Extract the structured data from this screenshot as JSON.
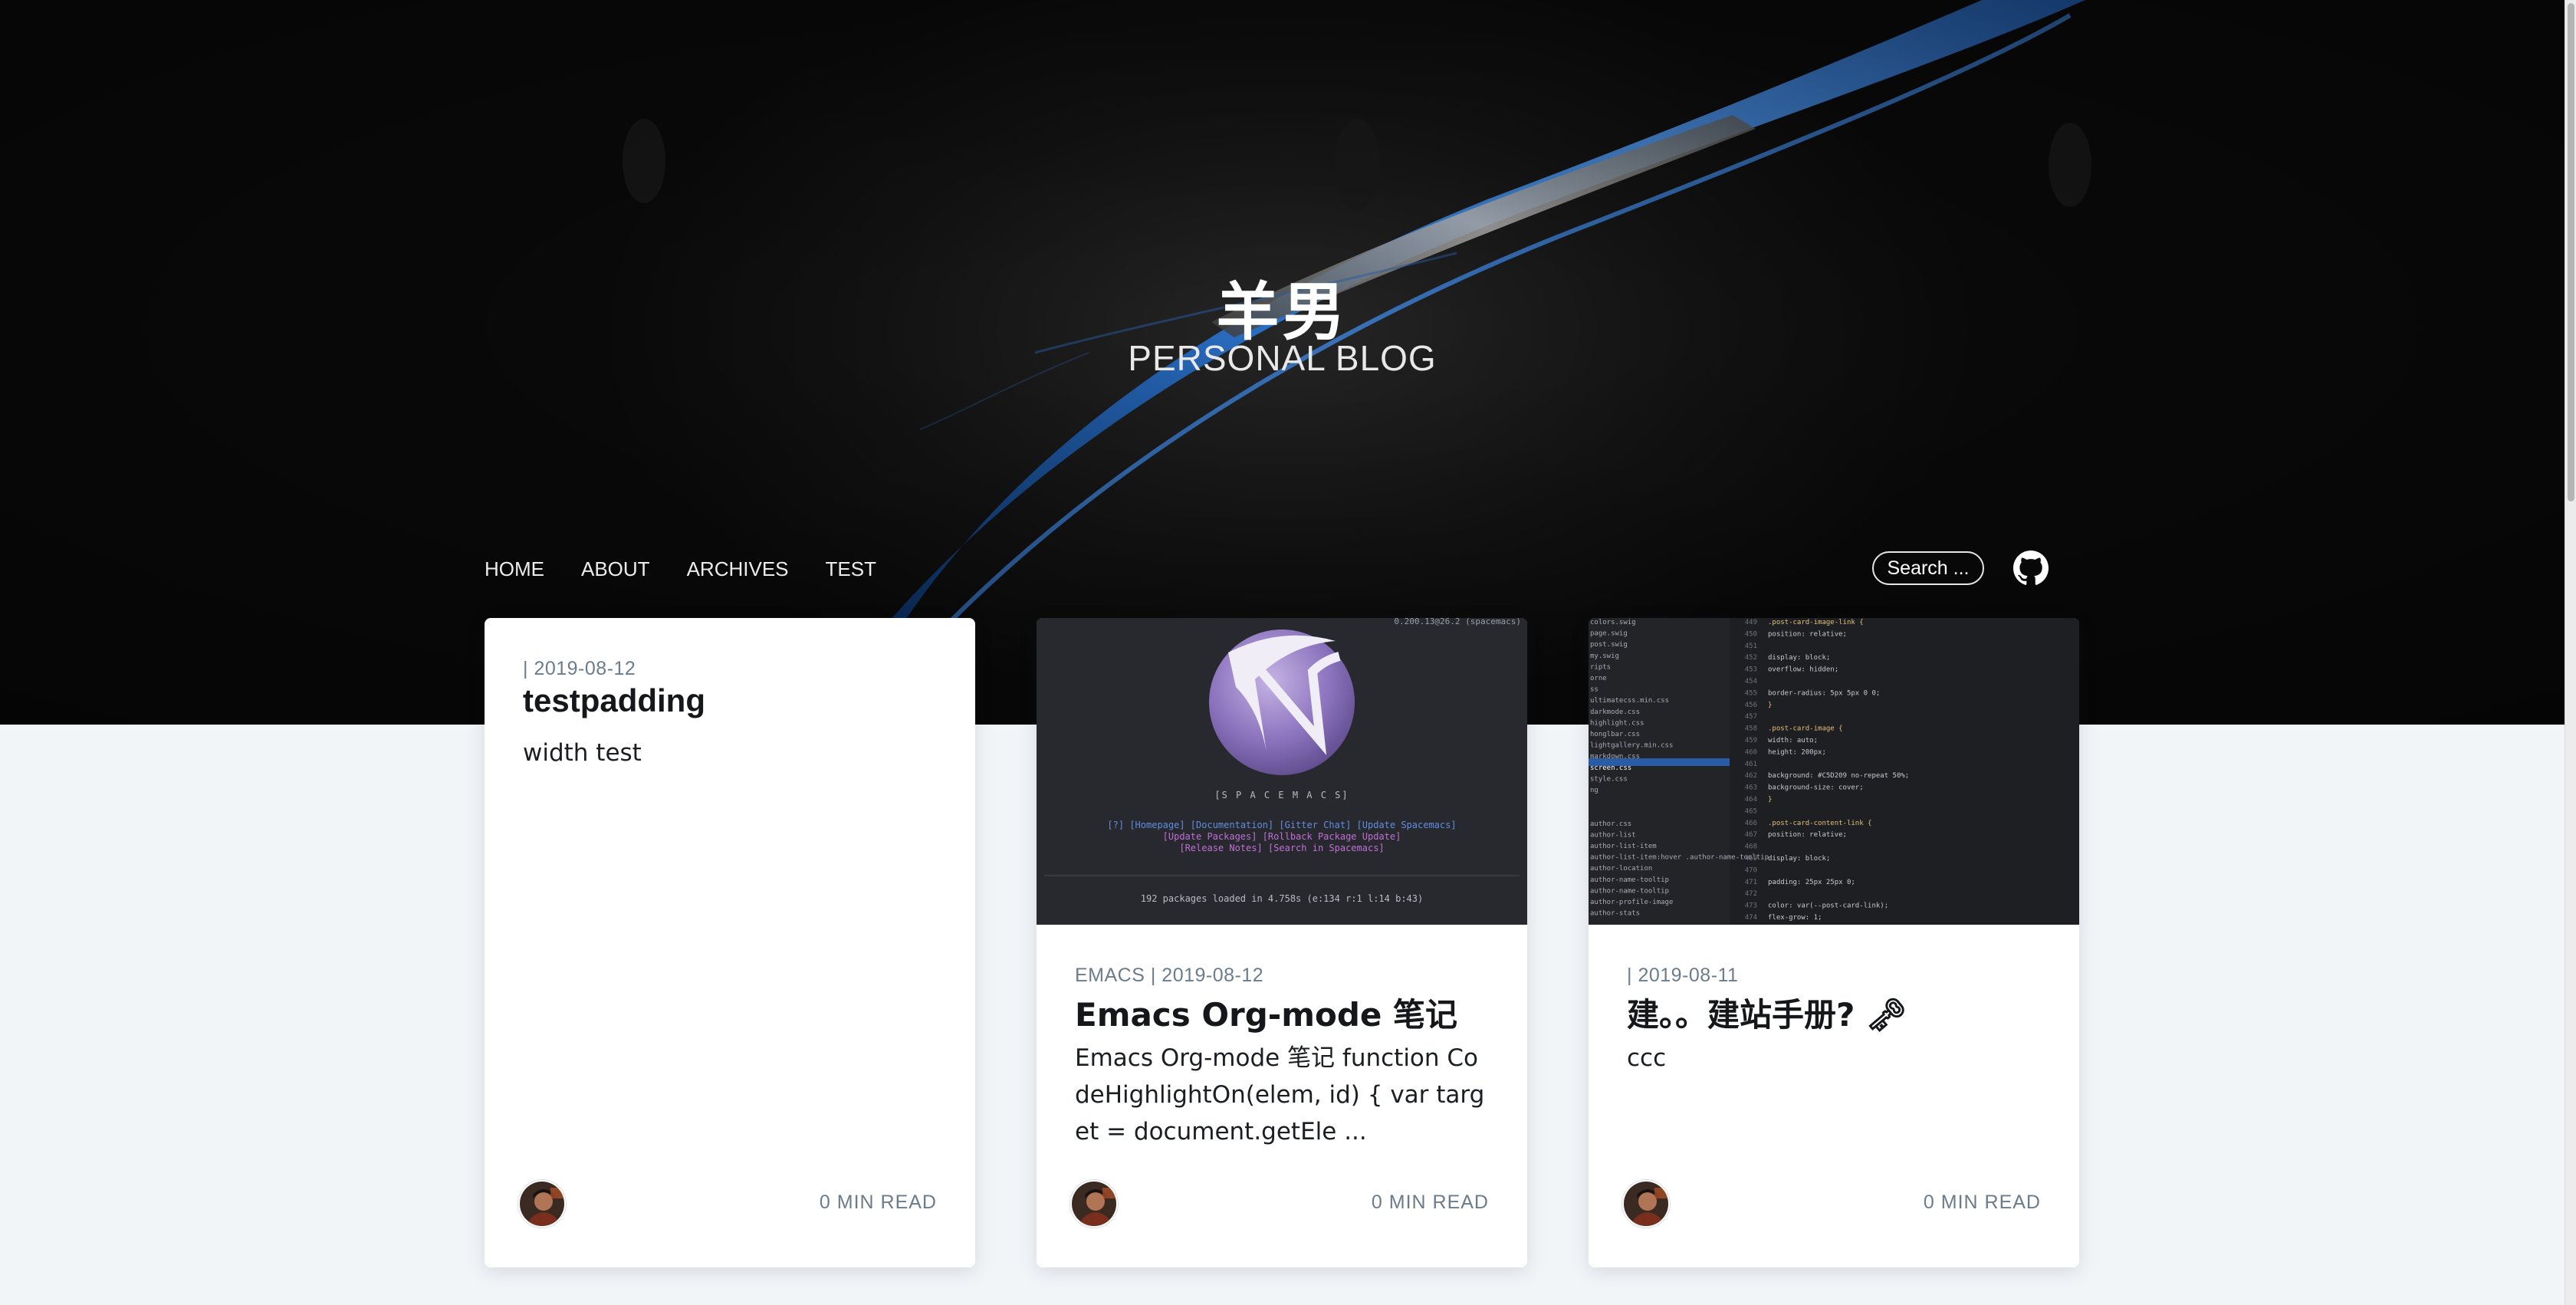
{
  "site": {
    "title": "羊男",
    "subtitle": "PERSONAL BLOG"
  },
  "nav": {
    "items": [
      {
        "label": "HOME"
      },
      {
        "label": "ABOUT"
      },
      {
        "label": "ARCHIVES"
      },
      {
        "label": "TEST"
      }
    ],
    "search_placeholder": "Search ...",
    "github_icon": "github-icon"
  },
  "posts": [
    {
      "meta": "| 2019-08-12",
      "title": "testpadding",
      "excerpt": "width test",
      "read_time": "0 MIN READ",
      "image": null
    },
    {
      "meta": "EMACS | 2019-08-12",
      "title": "Emacs Org-mode 笔记",
      "excerpt": "Emacs Org-mode 笔记 function CodeHighlightOn(elem, id) { var target = document.getEle ...",
      "read_time": "0 MIN READ",
      "image": {
        "version_text": "0.200.13@26.2 (spacemacs)",
        "banner": "[S P A C E M A C S]",
        "links_line1": "[?] [Homepage] [Documentation] [Gitter Chat] [Update Spacemacs]",
        "links_line2": "[Update Packages] [Rollback Package Update]",
        "links_line3": "[Release Notes] [Search in Spacemacs]",
        "status": "192 packages loaded in 4.758s (e:134 r:1 l:14 b:43)"
      }
    },
    {
      "meta": "| 2019-08-11",
      "title": "建。。建站手册? 🗝",
      "excerpt": "ccc",
      "read_time": "0 MIN READ",
      "image": {
        "code_lines": [
          {
            "n": "449",
            "t": ".post-card-image-link {"
          },
          {
            "n": "450",
            "t": "    position: relative;"
          },
          {
            "n": "451",
            "t": ""
          },
          {
            "n": "452",
            "t": "    display: block;"
          },
          {
            "n": "453",
            "t": "    overflow: hidden;"
          },
          {
            "n": "454",
            "t": ""
          },
          {
            "n": "455",
            "t": "    border-radius: 5px 5px 0 0;"
          },
          {
            "n": "456",
            "t": "}"
          },
          {
            "n": "457",
            "t": ""
          },
          {
            "n": "458",
            "t": ".post-card-image {"
          },
          {
            "n": "459",
            "t": "    width: auto;"
          },
          {
            "n": "460",
            "t": "    height: 200px;"
          },
          {
            "n": "461",
            "t": ""
          },
          {
            "n": "462",
            "t": "    background: #C5D209 no-repeat 50%;"
          },
          {
            "n": "463",
            "t": "    background-size: cover;"
          },
          {
            "n": "464",
            "t": "}"
          },
          {
            "n": "465",
            "t": ""
          },
          {
            "n": "466",
            "t": ".post-card-content-link {"
          },
          {
            "n": "467",
            "t": "    position: relative;"
          },
          {
            "n": "468",
            "t": ""
          },
          {
            "n": "469",
            "t": "    display: block;"
          },
          {
            "n": "470",
            "t": ""
          },
          {
            "n": "471",
            "t": "    padding: 25px 25px 0;"
          },
          {
            "n": "472",
            "t": ""
          },
          {
            "n": "473",
            "t": "    color: var(--post-card-link);"
          },
          {
            "n": "474",
            "t": "    flex-grow: 1;"
          }
        ],
        "file_list": [
          "colors.swig",
          "page.swig",
          "post.swig",
          "my.swig",
          "ripts",
          "orne",
          "ss",
          "ultimatecss.min.css",
          "darkmode.css",
          "highlight.css",
          "honglbar.css",
          "lightgallery.min.css",
          "markdown.css",
          "screen.css",
          "style.css",
          "ng",
          "",
          "",
          "author.css",
          "author-list",
          "author-list-item",
          "author-list-item:hover .author-name-tooltip",
          "author-location",
          "author-name-tooltip",
          "author-name-tooltip",
          "author-profile-image",
          "author-stats"
        ]
      }
    }
  ],
  "colors": {
    "accent_blue": "#2e7ad6",
    "meta_gray": "#6b7c8c",
    "page_bg": "#f2f5f8"
  }
}
